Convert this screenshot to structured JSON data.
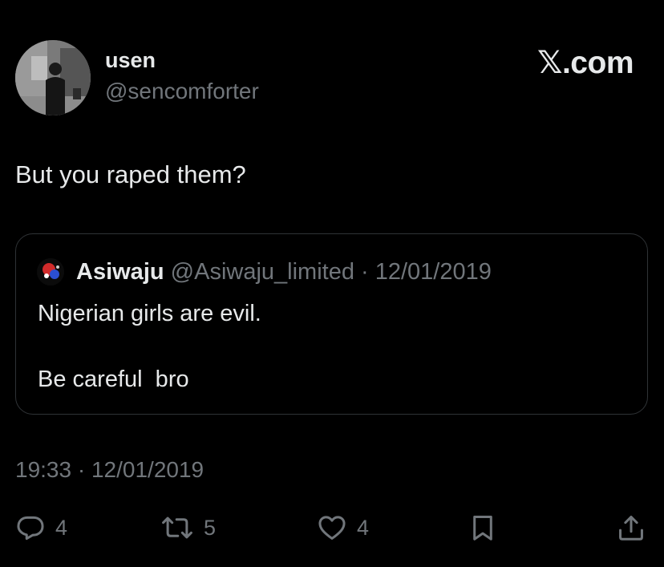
{
  "author": {
    "display_name": "usen",
    "handle": "@sencomforter",
    "avatar_icon": "user-photo-avatar"
  },
  "brand": {
    "label": "𝕏.com"
  },
  "tweet": {
    "text": "But you raped them?"
  },
  "quoted_tweet": {
    "display_name": "Asiwaju",
    "handle": "@Asiwaju_limited",
    "separator": " · ",
    "date": "12/01/2019",
    "line1": "Nigerian girls are evil.",
    "line2": "Be careful  bro"
  },
  "meta": {
    "time": "19:33",
    "separator": " · ",
    "date": "12/01/2019"
  },
  "actions": {
    "reply": {
      "icon": "reply-bubble-icon",
      "count": "4"
    },
    "repost": {
      "icon": "repost-arrows-icon",
      "count": "5"
    },
    "like": {
      "icon": "heart-icon",
      "count": "4"
    },
    "bookmark": {
      "icon": "bookmark-icon"
    },
    "share": {
      "icon": "share-upload-icon"
    }
  },
  "colors": {
    "background": "#000000",
    "primary_text": "#e7e9ea",
    "secondary_text": "#71767b",
    "border": "#2f3336"
  }
}
